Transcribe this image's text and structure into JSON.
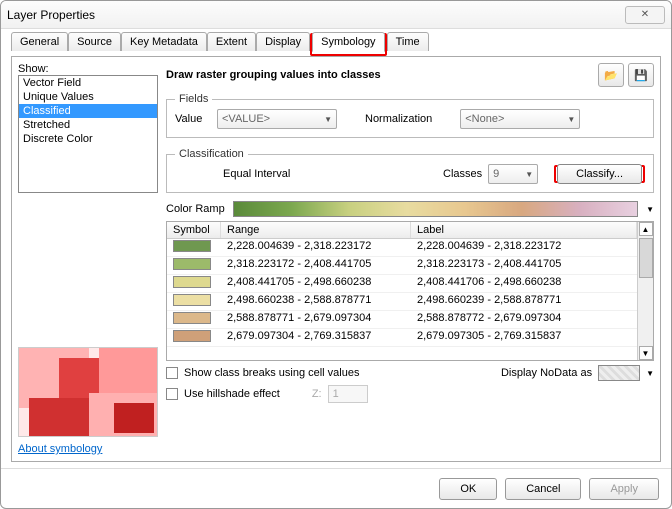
{
  "window": {
    "title": "Layer Properties",
    "close_label": "✕"
  },
  "tabs": [
    "General",
    "Source",
    "Key Metadata",
    "Extent",
    "Display",
    "Symbology",
    "Time"
  ],
  "active_tab_index": 5,
  "show": {
    "label": "Show:",
    "items": [
      "Vector Field",
      "Unique Values",
      "Classified",
      "Stretched",
      "Discrete Color"
    ],
    "selected_index": 2
  },
  "about_link": "About symbology",
  "header": "Draw raster grouping values into classes",
  "icons": {
    "open": "📂",
    "save": "💾"
  },
  "fields": {
    "legend": "Fields",
    "value_label": "Value",
    "value_combo": "<VALUE>",
    "norm_label": "Normalization",
    "norm_combo": "<None>"
  },
  "classification": {
    "legend": "Classification",
    "method": "Equal Interval",
    "classes_label": "Classes",
    "classes_value": "9",
    "classify_button": "Classify..."
  },
  "color_ramp_label": "Color Ramp",
  "grid": {
    "headers": {
      "symbol": "Symbol",
      "range": "Range",
      "label": "Label"
    },
    "rows": [
      {
        "color": "#6f9850",
        "range": "2,228.004639 - 2,318.223172",
        "label": "2,228.004639 - 2,318.223172"
      },
      {
        "color": "#9cba6a",
        "range": "2,318.223172 - 2,408.441705",
        "label": "2,318.223173 - 2,408.441705"
      },
      {
        "color": "#ded98f",
        "range": "2,408.441705 - 2,498.660238",
        "label": "2,408.441706 - 2,498.660238"
      },
      {
        "color": "#ecdfa4",
        "range": "2,498.660238 - 2,588.878771",
        "label": "2,498.660239 - 2,588.878771"
      },
      {
        "color": "#dcb88a",
        "range": "2,588.878771 - 2,679.097304",
        "label": "2,588.878772 - 2,679.097304"
      },
      {
        "color": "#cfa079",
        "range": "2,679.097304 - 2,769.315837",
        "label": "2,679.097305 - 2,769.315837"
      }
    ]
  },
  "options": {
    "show_breaks": "Show class breaks using cell values",
    "hillshade": "Use hillshade effect",
    "z_label": "Z:",
    "z_value": "1",
    "nodata_label": "Display NoData as"
  },
  "footer": {
    "ok": "OK",
    "cancel": "Cancel",
    "apply": "Apply"
  }
}
